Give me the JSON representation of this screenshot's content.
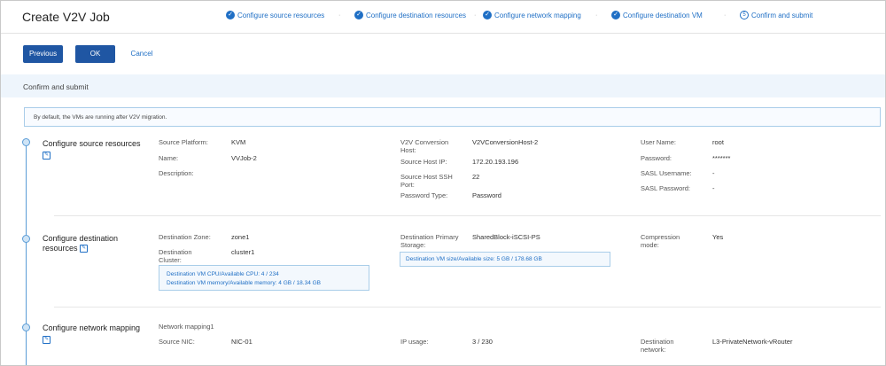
{
  "header": {
    "title": "Create V2V Job",
    "steps": [
      {
        "label": "Configure source resources",
        "state": "done"
      },
      {
        "label": "Configure destination resources",
        "state": "done"
      },
      {
        "label": "Configure network mapping",
        "state": "done"
      },
      {
        "label": "Configure destination VM",
        "state": "done"
      },
      {
        "label": "Confirm and submit",
        "state": "current",
        "number": "5"
      }
    ]
  },
  "actions": {
    "previous": "Previous",
    "ok": "OK",
    "cancel": "Cancel"
  },
  "section_title": "Confirm and submit",
  "notice": "By default, the VMs are running after V2V migration.",
  "source": {
    "title": "Configure source resources",
    "platform_label": "Source Platform:",
    "platform": "KVM",
    "name_label": "Name:",
    "name": "VVJob-2",
    "description_label": "Description:",
    "host_label": "V2V Conversion Host:",
    "host": "V2VConversionHost-2",
    "ip_label": "Source Host IP:",
    "ip": "172.20.193.196",
    "ssh_label": "Source Host SSH Port:",
    "ssh": "22",
    "pwtype_label": "Password Type:",
    "pwtype": "Password",
    "user_label": "User Name:",
    "user": "root",
    "password_label": "Password:",
    "password": "*******",
    "sasl_user_label": "SASL Username:",
    "sasl_user": "-",
    "sasl_pw_label": "SASL Password:",
    "sasl_pw": "-"
  },
  "destination": {
    "title": "Configure destination resources",
    "zone_label": "Destination Zone:",
    "zone": "zone1",
    "cluster_label": "Destination Cluster:",
    "cluster": "cluster1",
    "storage_label": "Destination Primary Storage:",
    "storage": "SharedBlock-iSCSI-PS",
    "compression_label": "Compression mode:",
    "compression": "Yes",
    "cpu_line": "Destination VM CPU/Available CPU:  4 / 234",
    "mem_line": "Destination VM memory/Available memory:  4 GB / 18.34 GB",
    "size_line": "Destination VM size/Available size:  5 GB / 178.68 GB"
  },
  "network": {
    "title": "Configure network mapping",
    "mapping_name": "Network mapping1",
    "nic_label": "Source NIC:",
    "nic": "NIC-01",
    "ip_usage_label": "IP usage:",
    "ip_usage": "3 / 230",
    "dest_net_label": "Destination network:",
    "dest_net": "L3-PrivateNetwork-vRouter"
  }
}
